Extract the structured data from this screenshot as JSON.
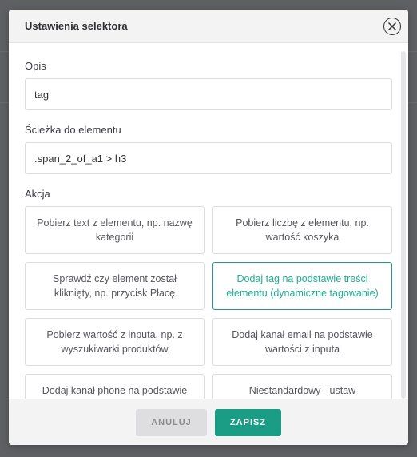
{
  "dialog": {
    "title": "Ustawienia selektora"
  },
  "fields": {
    "description_label": "Opis",
    "description_value": "tag",
    "path_label": "Ścieżka do elementu",
    "path_value": ".span_2_of_a1 > h3",
    "action_label": "Akcja"
  },
  "actions": [
    {
      "label": "Pobierz text z elementu, np. nazwę kategorii",
      "selected": false
    },
    {
      "label": "Pobierz liczbę z elementu, np. wartość koszyka",
      "selected": false
    },
    {
      "label": "Sprawdź czy element został kliknięty, np. przycisk Płacę",
      "selected": false
    },
    {
      "label": "Dodaj tag na podstawie treści elementu (dynamiczne tagowanie)",
      "selected": true
    },
    {
      "label": "Pobierz wartość z inputa, np. z wyszukiwarki produktów",
      "selected": false
    },
    {
      "label": "Dodaj kanał email na podstawie wartości z inputa",
      "selected": false
    },
    {
      "label": "Dodaj kanał phone na podstawie wartości z inputa",
      "selected": false
    },
    {
      "label": "Niestandardowy - ustaw samodzielnie",
      "selected": false
    }
  ],
  "footer": {
    "cancel_label": "ANULUJ",
    "save_label": "ZAPISZ"
  },
  "colors": {
    "accent": "#1b9c85",
    "overlay": "#5f6064"
  },
  "icons": {
    "close": "close-icon"
  }
}
